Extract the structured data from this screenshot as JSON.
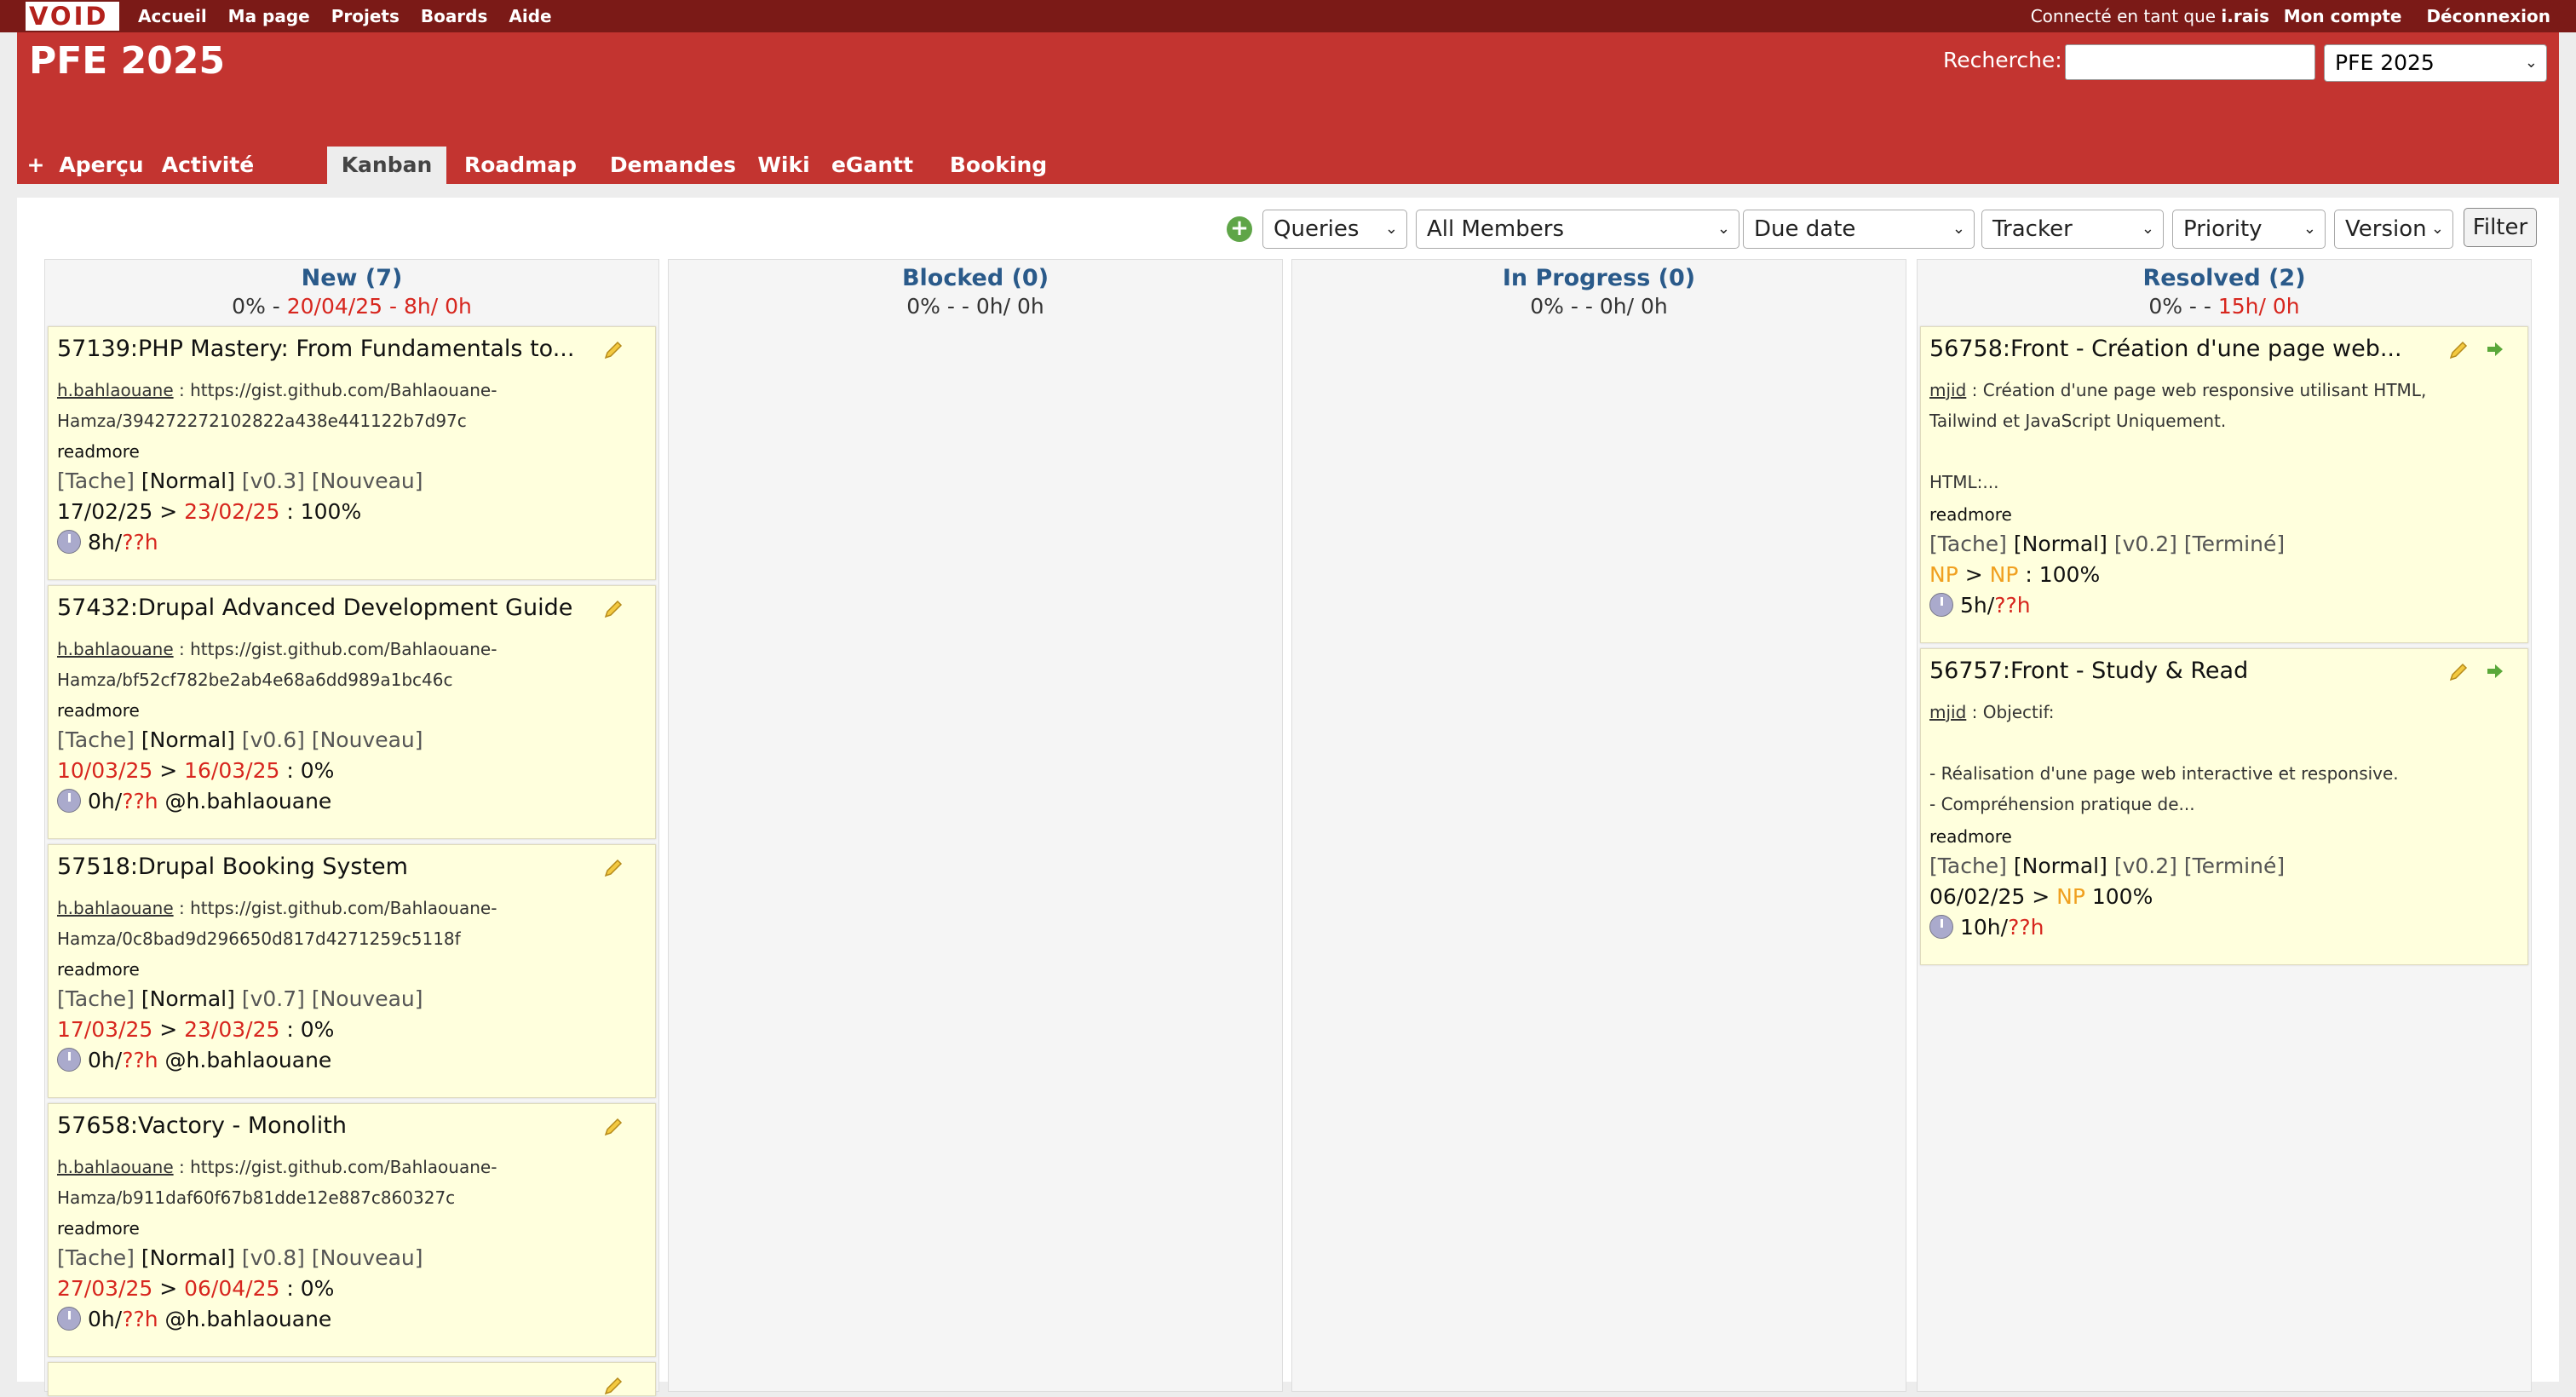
{
  "topbar": {
    "logo": "VOID",
    "nav": [
      "Accueil",
      "Ma page",
      "Projets",
      "Boards",
      "Aide"
    ],
    "logged_prefix": "Connecté en tant que ",
    "logged_user": "i.rais",
    "account": "Mon compte",
    "logout": "Déconnexion"
  },
  "header": {
    "project_title": "PFE 2025",
    "search_label": "Recherche:",
    "search_value": "",
    "project_select": "PFE 2025"
  },
  "tabs": [
    "+",
    "Aperçu",
    "Activité",
    "Kanban",
    "Roadmap",
    "Demandes",
    "Wiki",
    "eGantt",
    "Booking"
  ],
  "selected_tab": "Kanban",
  "filters": {
    "queries": "Queries",
    "members": "All Members",
    "due_date": "Due date",
    "tracker": "Tracker",
    "priority": "Priority",
    "version": "Version",
    "filter_button": "Filter"
  },
  "columns": [
    {
      "title": "New (7)",
      "stats_a": "0% - ",
      "stats_b": "20/04/25 - 8h/ 0h"
    },
    {
      "title": "Blocked (0)",
      "stats_a": "0% - - 0h/ 0h",
      "stats_b": ""
    },
    {
      "title": "In Progress (0)",
      "stats_a": "0% - - 0h/ 0h",
      "stats_b": ""
    },
    {
      "title": "Resolved (2)",
      "stats_a": "0% - - ",
      "stats_b": "15h/ 0h"
    }
  ],
  "cards": {
    "c1": {
      "title": "57139:PHP Mastery: From Fundamentals to...",
      "author": "h.bahlaouane",
      "desc1": " : https://gist.github.com/Bahlaouane-",
      "desc2": "Hamza/394272272102822a438e441122b7d97c",
      "readmore": "readmore",
      "tracker": "[Tache]",
      "priority": "[Normal]",
      "version": "[v0.3]",
      "status": "[Nouveau]",
      "start": "17/02/25",
      "sep": " > ",
      "due": "23/02/25",
      "progress": " : 100%",
      "time": "8h/",
      "estimate": "??h",
      "assignee": ""
    },
    "c2": {
      "title": "57432:Drupal Advanced Development Guide",
      "author": "h.bahlaouane",
      "desc1": " : https://gist.github.com/Bahlaouane-",
      "desc2": "Hamza/bf52cf782be2ab4e68a6dd989a1bc46c",
      "readmore": "readmore",
      "tracker": "[Tache]",
      "priority": "[Normal]",
      "version": "[v0.6]",
      "status": "[Nouveau]",
      "start": "10/03/25",
      "sep": " > ",
      "due": "16/03/25",
      "progress": " : 0%",
      "time": "0h/",
      "estimate": "??h",
      "assignee": " @h.bahlaouane"
    },
    "c3": {
      "title": "57518:Drupal Booking System",
      "author": "h.bahlaouane",
      "desc1": " : https://gist.github.com/Bahlaouane-",
      "desc2": "Hamza/0c8bad9d296650d817d4271259c5118f",
      "readmore": "readmore",
      "tracker": "[Tache]",
      "priority": "[Normal]",
      "version": "[v0.7]",
      "status": "[Nouveau]",
      "start": "17/03/25",
      "sep": " > ",
      "due": "23/03/25",
      "progress": " : 0%",
      "time": "0h/",
      "estimate": "??h",
      "assignee": " @h.bahlaouane"
    },
    "c4": {
      "title": "57658:Vactory - Monolith",
      "author": "h.bahlaouane",
      "desc1": " : https://gist.github.com/Bahlaouane-",
      "desc2": "Hamza/b911daf60f67b81dde12e887c860327c",
      "readmore": "readmore",
      "tracker": "[Tache]",
      "priority": "[Normal]",
      "version": "[v0.8]",
      "status": "[Nouveau]",
      "start": "27/03/25",
      "sep": " > ",
      "due": "06/04/25",
      "progress": " : 0%",
      "time": "0h/",
      "estimate": "??h",
      "assignee": " @h.bahlaouane"
    },
    "r1": {
      "title": "56758:Front - Création d'une page web...",
      "author": "mjid",
      "desc1": " : Création d'une page web responsive utilisant HTML,",
      "desc2": "Tailwind et JavaScript Uniquement.",
      "desc3": "HTML:...",
      "readmore": "readmore",
      "tracker": "[Tache]",
      "priority": "[Normal]",
      "version": "[v0.2]",
      "status": "[Terminé]",
      "start": "NP",
      "sep": " > ",
      "due": "NP",
      "progress": " : 100%",
      "time": "5h/",
      "estimate": "??h"
    },
    "r2": {
      "title": "56757:Front - Study & Read",
      "author": "mjid",
      "desc1": " : Objectif:",
      "desc2": "- Réalisation d'une page web interactive et responsive.",
      "desc3": "- Compréhension pratique de...",
      "readmore": "readmore",
      "tracker": "[Tache]",
      "priority": "[Normal]",
      "version": "[v0.2]",
      "status": "[Terminé]",
      "start": "06/02/25",
      "sep": " > ",
      "due": "NP",
      "progress": " 100%",
      "time": "10h/",
      "estimate": "??h"
    }
  }
}
